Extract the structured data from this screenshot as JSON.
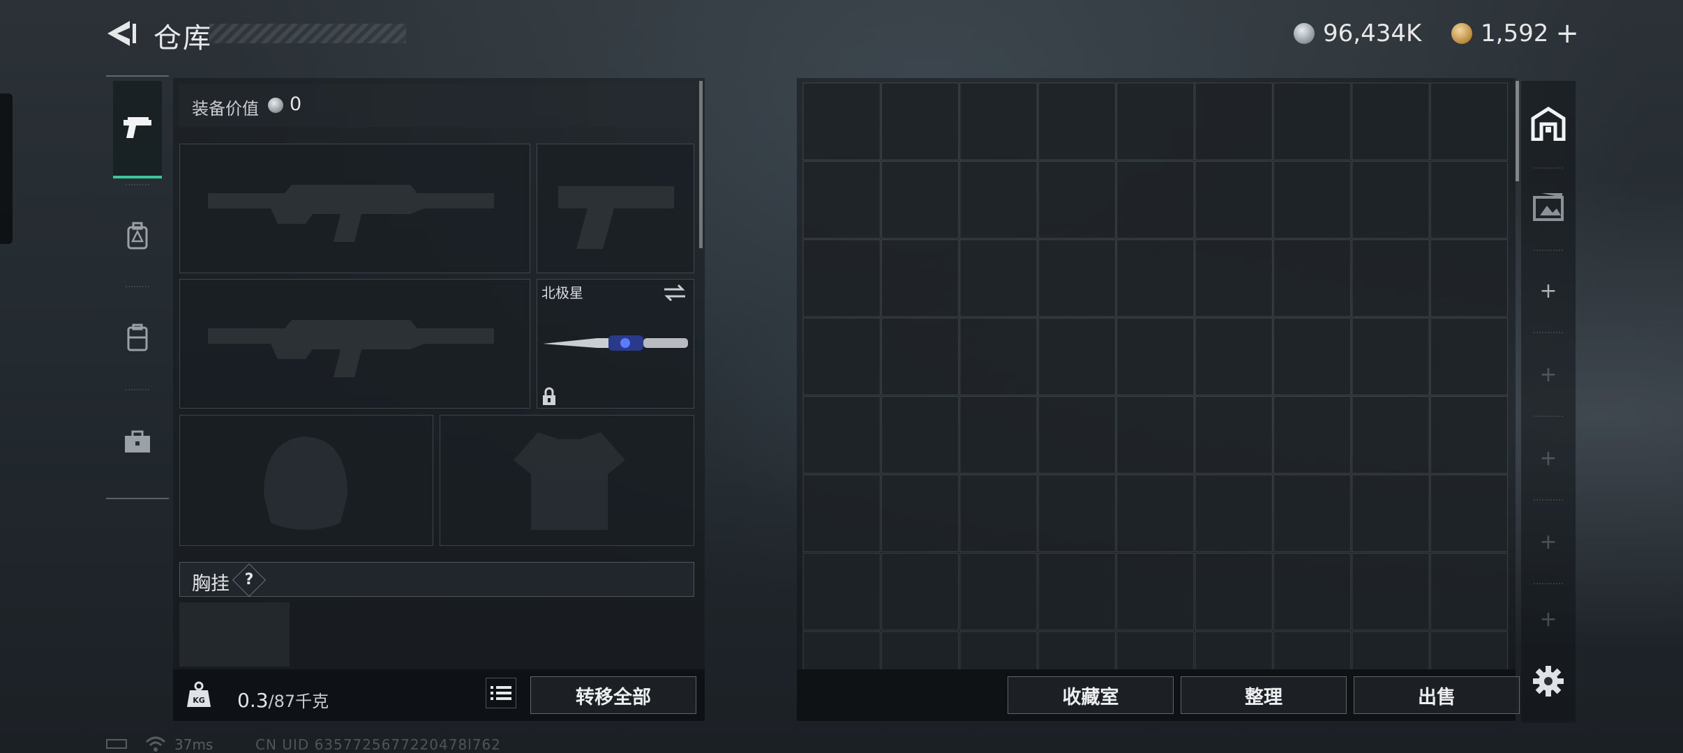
{
  "header": {
    "title": "仓库",
    "silver_amount": "96,434K",
    "gold_amount": "1,592",
    "plus_label": "+"
  },
  "left_nav": {
    "tabs": [
      {
        "icon": "pistol-icon",
        "active": true
      },
      {
        "icon": "backpack-icon",
        "active": false
      },
      {
        "icon": "vest-icon",
        "active": false
      },
      {
        "icon": "toolbox-icon",
        "active": false
      }
    ]
  },
  "equipment": {
    "value_label": "装备价值",
    "value_amount": "0",
    "melee_name": "北极星",
    "chest_label": "胸挂",
    "help_label": "?"
  },
  "bottom_left": {
    "weight_used": "0.3",
    "weight_total": "/87",
    "weight_unit": "千克",
    "transfer_all": "转移全部"
  },
  "stash": {
    "columns": 9,
    "visible_rows": 8,
    "collection_label": "收藏室",
    "sort_label": "整理",
    "sell_label": "出售"
  },
  "right_col": {
    "plus_label": "+"
  },
  "status": {
    "ping": "37ms",
    "uid": "CN UID 6357725677220478l762"
  },
  "colors": {
    "accent_green": "#3fc39a",
    "panel_dark": "#14181c",
    "text": "#e6e8ea"
  }
}
